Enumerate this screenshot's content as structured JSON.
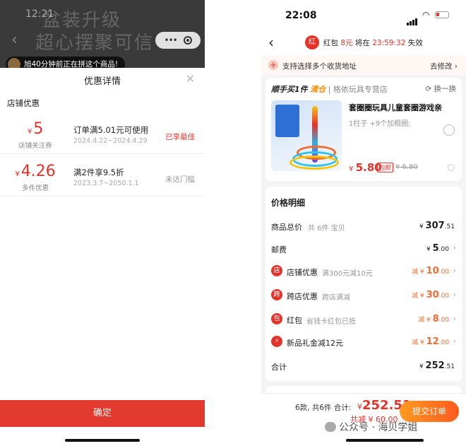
{
  "left": {
    "status_time": "12:21",
    "bg_title_1": "盆装升级",
    "bg_title_2": "超心摆聚可信",
    "group_toast": "旭40分钟前正在拼这个商品!",
    "sheet_title": "优惠详情",
    "section_title": "店铺优惠",
    "coupons": [
      {
        "currency": "¥",
        "amount": "5",
        "sub": "店铺关注券",
        "condition": "订单满5.01元可使用",
        "date": "2024.4.22~2024.4.29",
        "state": "已享最佳",
        "state_color": "#e5332a"
      },
      {
        "currency": "¥",
        "amount": "4.26",
        "sub": "多件优惠",
        "condition": "满2件享9.5折",
        "date": "2023.3.7~2050.1.1",
        "state": "未达门槛",
        "state_color": "#999999"
      }
    ],
    "confirm_label": "确定"
  },
  "right": {
    "status_time": "22:08",
    "red_packet": {
      "icon": "红",
      "prefix": "红包",
      "amount": "8元",
      "mid": "将在",
      "countdown": "23:59:32",
      "suffix": "失效"
    },
    "address": {
      "text": "支持选择多个收货地址",
      "action": "去修改 ›"
    },
    "bundle": {
      "title": "顺手买1件",
      "tag": "清仓",
      "shop": "| 格依玩具专营店",
      "swap": "⟳ 换一换",
      "product_name": "套圈圈玩具儿童套圈游戏亲",
      "spec": "1柱子 +9个加粗圈;",
      "currency": "¥",
      "price": "5.80",
      "price_tag": "包邮",
      "old_price": "¥ 6.80"
    },
    "price_detail": {
      "title": "价格明细",
      "rows": [
        {
          "label": "商品总价",
          "desc": "共 6件 宝贝",
          "value_prefix": "¥ ",
          "value": "307",
          "value_small": ".51",
          "red": false,
          "icon": ""
        },
        {
          "label": "邮费",
          "desc": "",
          "value_prefix": "¥ ",
          "value": "5",
          "value_small": ".00",
          "red": false,
          "icon": ""
        },
        {
          "label": "店铺优惠",
          "desc": "满300元减10元",
          "value_prefix": "减 ¥ ",
          "value": "10",
          "value_small": ".00",
          "red": true,
          "icon": "店"
        },
        {
          "label": "跨店优惠",
          "desc": "跨店满减",
          "value_prefix": "减 ¥ ",
          "value": "30",
          "value_small": ".00",
          "red": true,
          "icon": "跨"
        },
        {
          "label": "红包",
          "desc": "省钱卡红包已抵",
          "value_prefix": "减 ¥ ",
          "value": "8",
          "value_small": ".00",
          "red": true,
          "icon": "包"
        },
        {
          "label": "新品礼金减12元",
          "desc": "",
          "value_prefix": "减 ¥ ",
          "value": "12",
          "value_small": ".00",
          "red": true,
          "icon": "⚡"
        },
        {
          "label": "合计",
          "desc": "",
          "value_prefix": "¥ ",
          "value": "252",
          "value_small": ".51",
          "red": false,
          "icon": ""
        }
      ]
    },
    "bottom": {
      "count": "6款, 共6件 合计:",
      "currency": "¥",
      "total": "252.51",
      "saved": "共减 ¥ 60.00",
      "submit": "提交订单"
    }
  },
  "watermark": "公众号 · 海贝学姐",
  "colors": {
    "accent_red": "#e5332a",
    "accent_orange": "#ff7a1f"
  }
}
